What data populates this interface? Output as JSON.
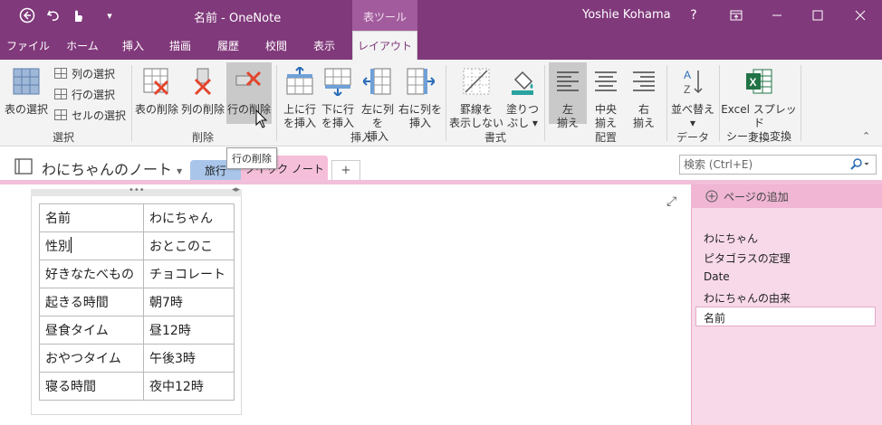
{
  "window": {
    "title": "名前 - OneNote",
    "context_tab": "表ツール",
    "user": "Yoshie Kohama",
    "help": "?",
    "controls": {
      "minimize": "—",
      "maximize": "☐",
      "close": "✕",
      "ribbon_display": "⧉"
    }
  },
  "tabs": [
    "ファイル",
    "ホーム",
    "挿入",
    "描画",
    "履歴",
    "校閲",
    "表示",
    "レイアウト"
  ],
  "active_tab": "レイアウト",
  "ribbon": {
    "select": {
      "label": "選択",
      "table_select": "表の選択",
      "col_select": "列の選択",
      "row_select": "行の選択",
      "cell_select": "セルの選択"
    },
    "delete": {
      "label": "削除",
      "delete_table": "表の削除",
      "delete_column": "列の削除",
      "delete_row": "行の削除"
    },
    "insert": {
      "label": "挿入",
      "insert_above_1": "上に行",
      "insert_above_2": "を挿入",
      "insert_below_1": "下に行",
      "insert_below_2": "を挿入",
      "insert_left_1": "左に列を",
      "insert_left_2": "挿入",
      "insert_right_1": "右に列を",
      "insert_right_2": "挿入"
    },
    "format": {
      "label": "書式",
      "hide_borders_1": "罫線を",
      "hide_borders_2": "表示しない",
      "shading_1": "塗りつ",
      "shading_2": "ぶし"
    },
    "alignment": {
      "label": "配置",
      "left_1": "左",
      "left_2": "揃え",
      "center_1": "中央",
      "center_2": "揃え",
      "right_1": "右",
      "right_2": "揃え"
    },
    "data": {
      "label": "データ",
      "sort": "並べ替え"
    },
    "convert": {
      "label": "変換",
      "excel_1": "Excel スプレッド",
      "excel_2": "シートに変換"
    }
  },
  "tooltip": "行の削除",
  "notebook": {
    "name": "わにちゃんのノート",
    "sections": [
      {
        "label": "旅行",
        "color": "#a9c6ea"
      },
      {
        "label": "クイック ノート",
        "color": "#f5bed9"
      }
    ],
    "add_section": "+",
    "search_placeholder": "検索 (Ctrl+E)"
  },
  "table": [
    [
      "名前",
      "わにちゃん"
    ],
    [
      "性別",
      "おとこのこ"
    ],
    [
      "好きなたべもの",
      "チョコレート"
    ],
    [
      "起きる時間",
      "朝7時"
    ],
    [
      "昼食タイム",
      "昼12時"
    ],
    [
      "おやつタイム",
      "午後3時"
    ],
    [
      "寝る時間",
      "夜中12時"
    ]
  ],
  "pages": {
    "add_page": "ページの追加",
    "items": [
      "わにちゃん",
      "ピタゴラスの定理",
      "Date",
      "わにちゃんの由来",
      "名前"
    ]
  },
  "colors": {
    "accent": "#80397b",
    "section_pink": "#f5bed9",
    "pages_bg": "#f8d9e9"
  }
}
